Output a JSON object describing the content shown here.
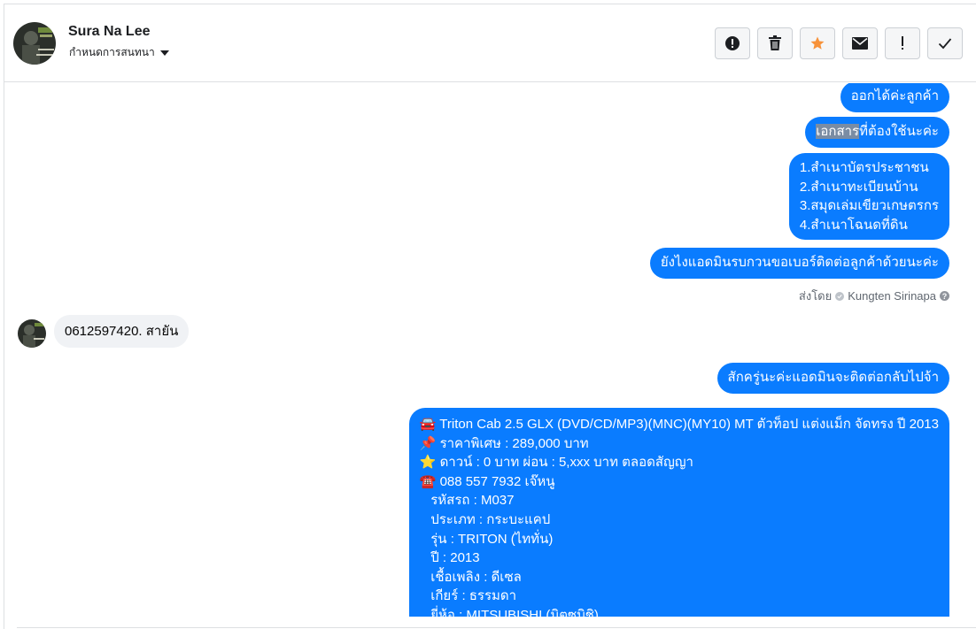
{
  "header": {
    "name": "Sura Na Lee",
    "subtitle": "กำหนดการสนทนา",
    "actions": [
      {
        "id": "spam",
        "icon": "exclamation-circle-icon"
      },
      {
        "id": "delete",
        "icon": "trash-icon"
      },
      {
        "id": "star",
        "icon": "star-icon",
        "color": "#f7923a"
      },
      {
        "id": "unread",
        "icon": "envelope-icon"
      },
      {
        "id": "follow-up",
        "icon": "exclamation-icon"
      },
      {
        "id": "done",
        "icon": "checkmark-icon"
      }
    ]
  },
  "messages": {
    "m1": "ออกได้ค่ะลูกค้า",
    "m2_highlight": "เอกสาร",
    "m2_rest": "ที่ต้องใช้นะค่ะ",
    "m3": "1.สำเนาบัตรประชาชน\n2.สำเนาทะเบียนบ้าน\n3.สมุดเล่มเขียวเกษตรกร\n4.สำเนาโฉนดที่ดิน",
    "m4": "ยังไงแอดมินรบกวนขอเบอร์ติดต่อลูกค้าด้วยนะค่ะ",
    "sent_by_label": "ส่งโดย",
    "sent_by_name": "Kungten Sirinapa",
    "in1": "0612597420. สายัน",
    "m5": "สักครู่นะค่ะแอดมินจะติดต่อกลับไปจ้า",
    "m6": "🚘 Triton Cab 2.5 GLX (DVD/CD/MP3)(MNC)(MY10) MT ตัวท็อป แต่งแม็ก จัดทรง ปี 2013\n📌 ราคาพิเศษ : 289,000 บาท\n⭐ ดาวน์ : 0 บาท ผ่อน : 5,xxx บาท ตลอดสัญญา\n☎️ 088 557 7932 เจ๊หนู\n   รหัสรถ : M037\n   ประเภท : กระบะแคป\n   รุ่น : TRITON (ไททั่น)\n   ปี : 2013\n   เชื้อเพลิง : ดีเซล\n   เกียร์ : ธรรมดา\n   ยี่ห้อ : MITSUBISHI (มิตซูบิชิ)"
  },
  "colors": {
    "accent": "#0a7cff",
    "incoming_bg": "#f0f2f5"
  }
}
